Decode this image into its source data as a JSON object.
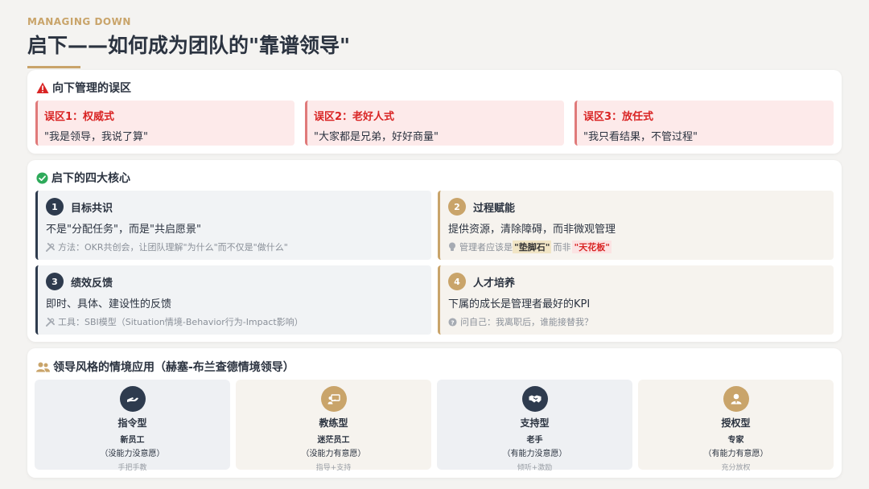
{
  "header": {
    "eyebrow": "MANAGING DOWN",
    "title": "启下——如何成为团队的\"靠谱领导\""
  },
  "colors": {
    "navy": "#2e3b4e",
    "gold": "#c9a46a",
    "red": "#d92424",
    "myth_bg": "#fdeaea"
  },
  "myths": {
    "title": "向下管理的误区",
    "icon": "warning-icon",
    "items": [
      {
        "title": "误区1：权威式",
        "quote": "\"我是领导，我说了算\""
      },
      {
        "title": "误区2：老好人式",
        "quote": "\"大家都是兄弟，好好商量\""
      },
      {
        "title": "误区3：放任式",
        "quote": "\"我只看结果，不管过程\""
      }
    ]
  },
  "cores": {
    "title": "启下的四大核心",
    "icon": "check-circle-icon",
    "items": [
      {
        "num": "1",
        "title": "目标共识",
        "desc": "不是\"分配任务\"，而是\"共启愿景\"",
        "note_icon": "tools-icon",
        "note": "方法：OKR共创会，让团队理解\"为什么\"而不仅是\"做什么\""
      },
      {
        "num": "2",
        "title": "过程赋能",
        "desc": "提供资源，清除障碍，而非微观管理",
        "note_icon": "lightbulb-icon",
        "note_pre": "管理者应该是",
        "note_hl1": "\"垫脚石\"",
        "note_mid": "而非",
        "note_hl2": "\"天花板\""
      },
      {
        "num": "3",
        "title": "绩效反馈",
        "desc": "即时、具体、建设性的反馈",
        "note_icon": "tools-icon",
        "note": "工具：SBI模型（Situation情境-Behavior行为-Impact影响）"
      },
      {
        "num": "4",
        "title": "人才培养",
        "desc": "下属的成长是管理者最好的KPI",
        "note_icon": "question-icon",
        "note": "问自己：我离职后，谁能接替我？"
      }
    ]
  },
  "styles": {
    "title": "领导风格的情境应用（赫塞-布兰查德情境领导）",
    "icon": "users-icon",
    "items": [
      {
        "name": "指令型",
        "who": "新员工",
        "cond": "（没能力没意愿）",
        "action": "手把手教",
        "icon": "hand-icon"
      },
      {
        "name": "教练型",
        "who": "迷茫员工",
        "cond": "（没能力有意愿）",
        "action": "指导+支持",
        "icon": "chalkboard-teacher-icon"
      },
      {
        "name": "支持型",
        "who": "老手",
        "cond": "（有能力没意愿）",
        "action": "倾听+激励",
        "icon": "handshake-icon"
      },
      {
        "name": "授权型",
        "who": "专家",
        "cond": "（有能力有意愿）",
        "action": "充分放权",
        "icon": "user-tie-icon"
      }
    ]
  }
}
